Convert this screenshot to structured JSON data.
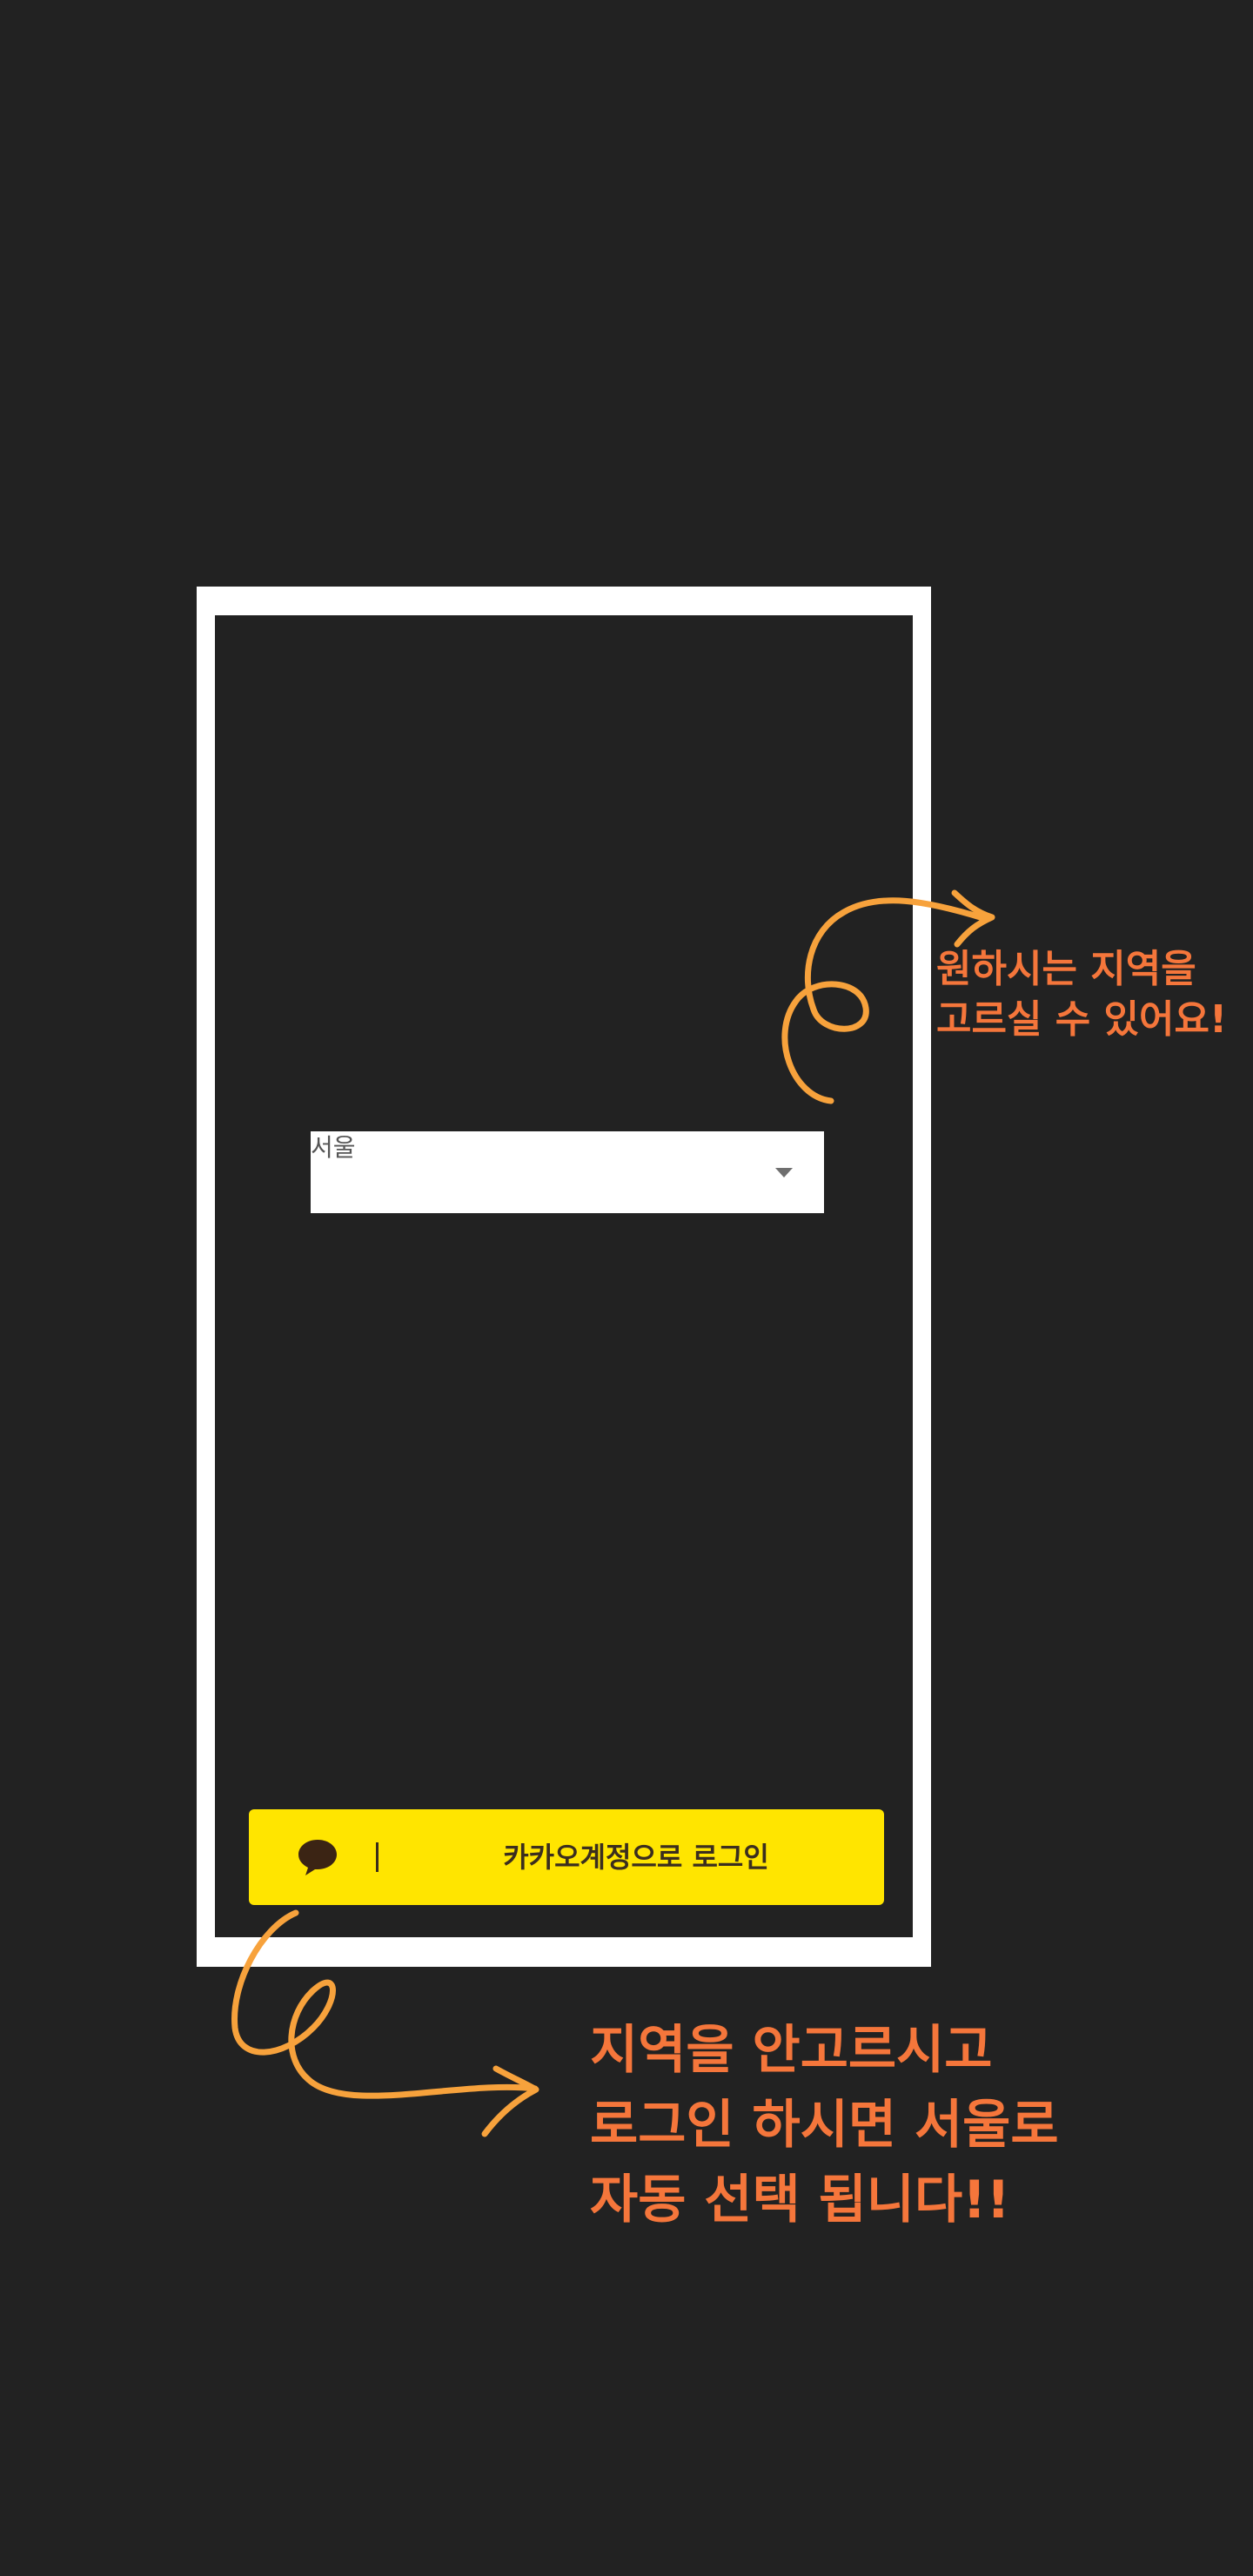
{
  "region_select": {
    "selected_value": "서울",
    "dropdown_icon": "caret-down-icon"
  },
  "login_button": {
    "icon": "kakao-speech-bubble-icon",
    "label": "카카오계정으로 로그인",
    "background_color": "#ffe500",
    "text_color": "#3b2e1e"
  },
  "annotations": {
    "top_hint": {
      "line1": "원하시는 지역을",
      "line2": "고르실 수 있어요!"
    },
    "bottom_hint": {
      "line1": "지역을 안고르시고",
      "line2": "로그인 하시면 서울로",
      "line3": "자동 선택 됩니다!!"
    },
    "arrow_color": "#f7a23c",
    "text_color": "#f5763b"
  },
  "colors": {
    "background": "#222222",
    "frame": "#ffffff"
  }
}
